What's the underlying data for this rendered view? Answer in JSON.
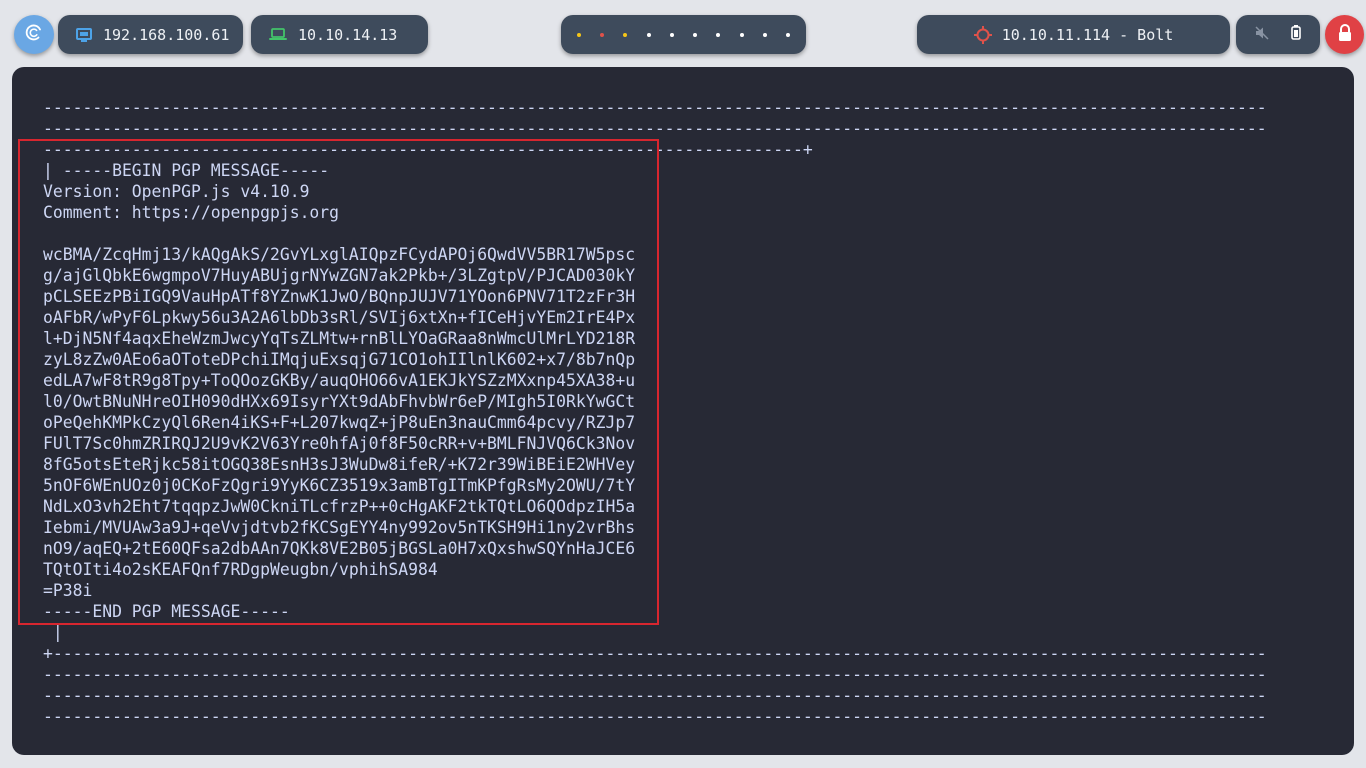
{
  "topbar": {
    "menu_icon": "debian-swirl-icon",
    "host_ip": {
      "icon": "monitor-icon",
      "value": "192.168.100.61"
    },
    "vpn_ip": {
      "icon": "laptop-icon",
      "value": "10.10.14.13"
    },
    "workspaces": {
      "count": 10,
      "colors": [
        "#f5c518",
        "#e0524a",
        "#f5c518",
        "#ffffff",
        "#ffffff",
        "#ffffff",
        "#ffffff",
        "#ffffff",
        "#ffffff",
        "#ffffff"
      ]
    },
    "target": {
      "icon": "crosshair-icon",
      "label": "10.10.11.114 - Bolt",
      "color": "#e0524a"
    },
    "system": {
      "volume_icon": "volume-muted-icon",
      "battery_icon": "battery-icon"
    },
    "lock_icon": "lock-icon"
  },
  "terminal": {
    "lines": [
      "----------------------------------------------------------------------------------------------------------------------------",
      "----------------------------------------------------------------------------------------------------------------------------",
      "-----------------------------------------------------------------------------+",
      "| -----BEGIN PGP MESSAGE-----",
      "Version: OpenPGP.js v4.10.9",
      "Comment: https://openpgpjs.org",
      "",
      "wcBMA/ZcqHmj13/kAQgAkS/2GvYLxglAIQpzFCydAPOj6QwdVV5BR17W5psc",
      "g/ajGlQbkE6wgmpoV7HuyABUjgrNYwZGN7ak2Pkb+/3LZgtpV/PJCAD030kY",
      "pCLSEEzPBiIGQ9VauHpATf8YZnwK1JwO/BQnpJUJV71YOon6PNV71T2zFr3H",
      "oAFbR/wPyF6Lpkwy56u3A2A6lbDb3sRl/SVIj6xtXn+fICeHjvYEm2IrE4Px",
      "l+DjN5Nf4aqxEheWzmJwcyYqTsZLMtw+rnBlLYOaGRaa8nWmcUlMrLYD218R",
      "zyL8zZw0AEo6aOToteDPchiIMqjuExsqjG71CO1ohIIlnlK602+x7/8b7nQp",
      "edLA7wF8tR9g8Tpy+ToQOozGKBy/auqOHO66vA1EKJkYSZzMXxnp45XA38+u",
      "l0/OwtBNuNHreOIH090dHXx69IsyrYXt9dAbFhvbWr6eP/MIgh5I0RkYwGCt",
      "oPeQehKMPkCzyQl6Ren4iKS+F+L207kwqZ+jP8uEn3nauCmm64pcvy/RZJp7",
      "FUlT7Sc0hmZRIRQJ2U9vK2V63Yre0hfAj0f8F50cRR+v+BMLFNJVQ6Ck3Nov",
      "8fG5otsEteRjkc58itOGQ38EsnH3sJ3WuDw8ifeR/+K72r39WiBEiE2WHVey",
      "5nOF6WEnUOz0j0CKoFzQgri9YyK6CZ3519x3amBTgITmKPfgRsMy2OWU/7tY",
      "NdLxO3vh2Eht7tqqpzJwW0CkniTLcfrzP++0cHgAKF2tkTQtLO6QOdpzIH5a",
      "Iebmi/MVUAw3a9J+qeVvjdtvb2fKCSgEYY4ny992ov5nTKSH9Hi1ny2vrBhs",
      "nO9/aqEQ+2tE60QFsa2dbAAn7QKk8VE2B05jBGSLa0H7xQxshwSQYnHaJCE6",
      "TQtOIti4o2sKEAFQnf7RDgpWeugbn/vphihSA984",
      "=P38i",
      "-----END PGP MESSAGE-----",
      " |",
      "+---------------------------------------------------------------------------------------------------------------------------",
      "----------------------------------------------------------------------------------------------------------------------------",
      "----------------------------------------------------------------------------------------------------------------------------",
      "----------------------------------------------------------------------------------------------------------------------------"
    ],
    "highlight_color": "#d7262f"
  }
}
